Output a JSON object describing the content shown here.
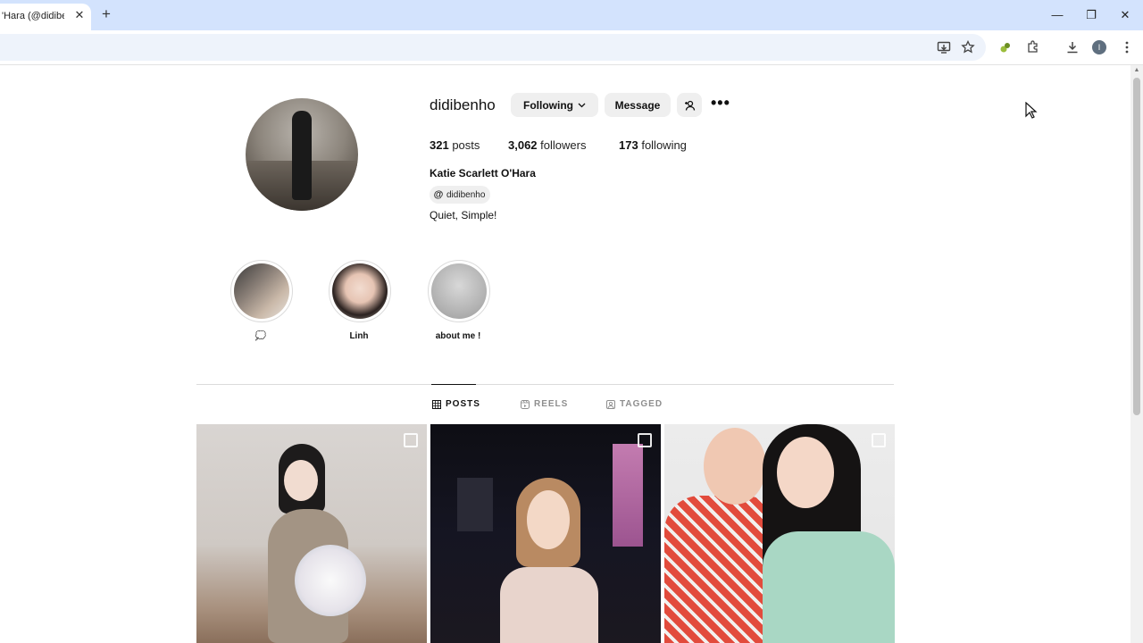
{
  "browser": {
    "tab_title": "'Hara (@didiben",
    "tab_close": "✕",
    "new_tab": "+",
    "window_controls": {
      "minimize": "—",
      "restore": "❐",
      "close": "✕"
    },
    "profile_initial": "I"
  },
  "profile": {
    "username": "didibenho",
    "following_button": "Following",
    "message_button": "Message",
    "more_glyph": "•••",
    "stats": {
      "posts_count": "321",
      "posts_label": "posts",
      "followers_count": "3,062",
      "followers_label": "followers",
      "following_count": "173",
      "following_label": "following"
    },
    "full_name": "Katie Scarlett O'Hara",
    "threads_handle": "didibenho",
    "bio": "Quiet, Simple!"
  },
  "highlights": [
    {
      "label": "💭"
    },
    {
      "label": "Linh"
    },
    {
      "label": "about me !"
    }
  ],
  "tabs": [
    {
      "label": "POSTS",
      "active": true
    },
    {
      "label": "REELS",
      "active": false
    },
    {
      "label": "TAGGED",
      "active": false
    }
  ],
  "colors": {
    "tabbar": "#d3e3fd",
    "button_bg": "#efefef",
    "muted_text": "#8e8e8e"
  }
}
